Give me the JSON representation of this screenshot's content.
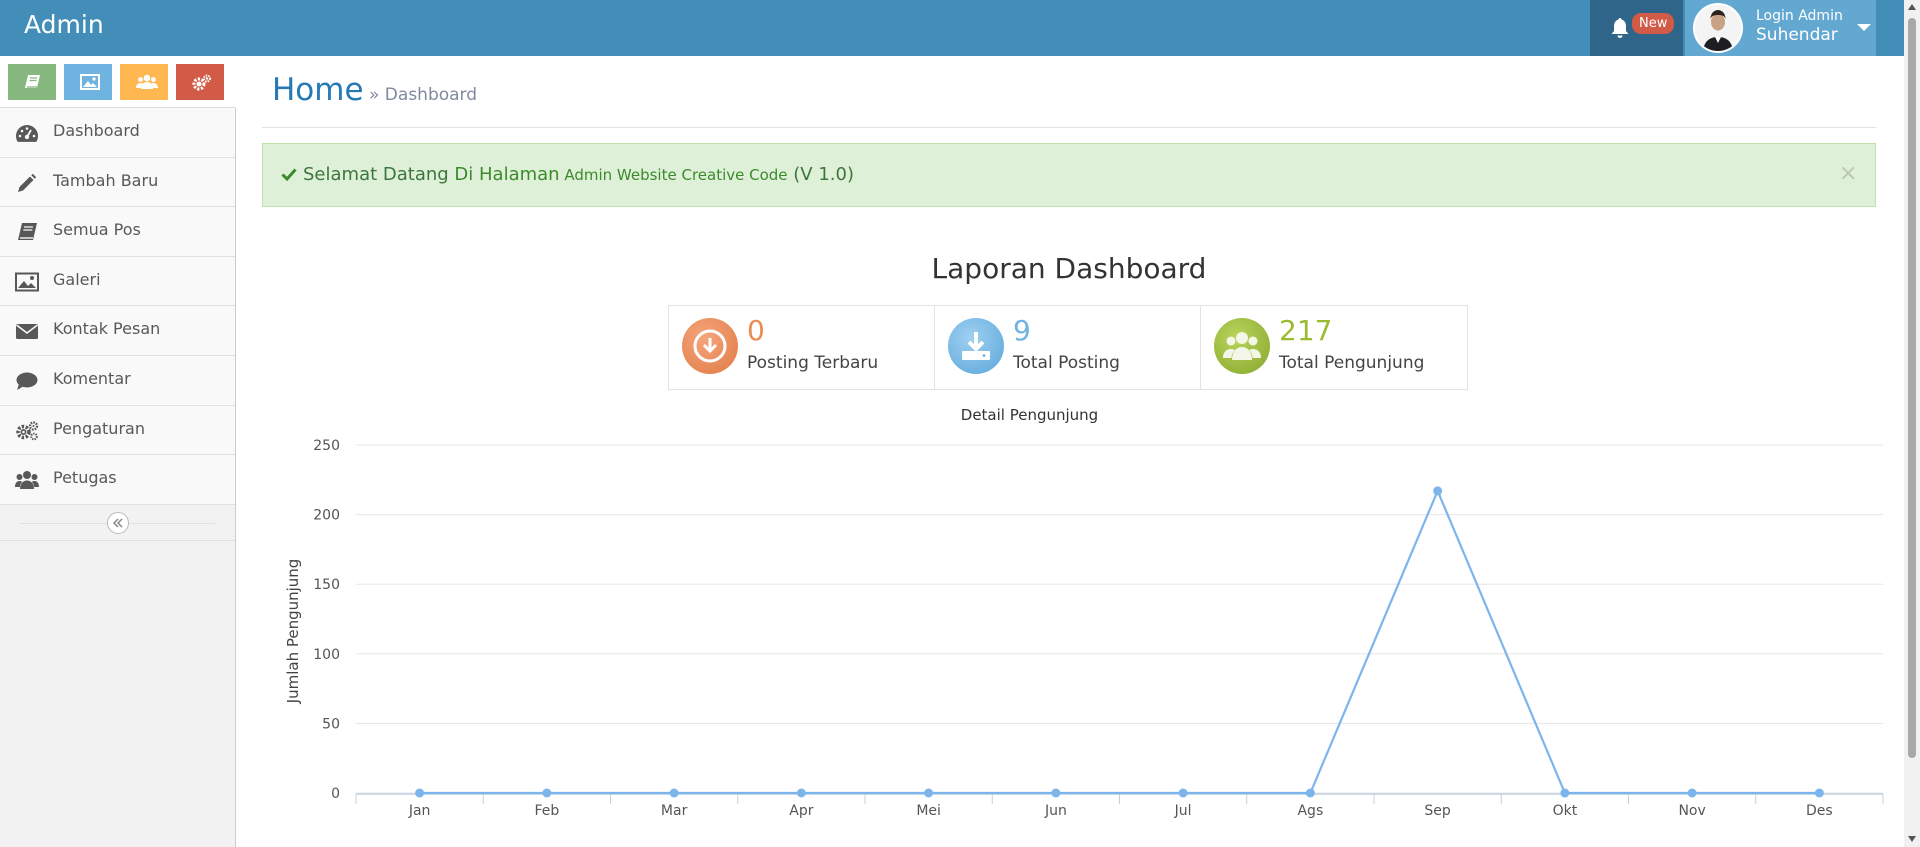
{
  "navbar": {
    "brand": "Admin",
    "notif_badge": "New",
    "user_small": "Login Admin",
    "user_name": "Suhendar"
  },
  "sidebar": {
    "shortcuts": [
      {
        "name": "book-icon",
        "color": "#87b87f"
      },
      {
        "name": "picture-icon",
        "color": "#6fb3e0"
      },
      {
        "name": "users-icon",
        "color": "#ffb752"
      },
      {
        "name": "cogs-icon",
        "color": "#d15b47"
      }
    ],
    "items": [
      {
        "label": "Dashboard",
        "icon": "dashboard-icon"
      },
      {
        "label": "Tambah Baru",
        "icon": "pencil-icon"
      },
      {
        "label": "Semua Pos",
        "icon": "book-icon"
      },
      {
        "label": "Galeri",
        "icon": "picture-icon"
      },
      {
        "label": "Kontak Pesan",
        "icon": "envelope-icon"
      },
      {
        "label": "Komentar",
        "icon": "comment-icon"
      },
      {
        "label": "Pengaturan",
        "icon": "cogs-icon"
      },
      {
        "label": "Petugas",
        "icon": "users-icon"
      }
    ]
  },
  "main": {
    "title": "Home",
    "breadcrumb": "» Dashboard",
    "alert": {
      "prefix": "Selamat Datang ",
      "highlight": "Di Halaman",
      "small": " Admin Website Creative Code",
      "suffix": " (V 1.0)",
      "close": "×"
    },
    "dash_title": "Laporan Dashboard",
    "stats": [
      {
        "value": "0",
        "label": "Posting Terbaru",
        "color": "#e98c58",
        "icon": "download-circle-icon"
      },
      {
        "value": "9",
        "label": "Total Posting",
        "color": "#6fb3e0",
        "icon": "download-icon"
      },
      {
        "value": "217",
        "label": "Total Pengunjung",
        "color": "#9abc32",
        "icon": "users-icon"
      }
    ]
  },
  "chart_data": {
    "type": "line",
    "title": "Detail Pengunjung",
    "ylabel": "Jumlah Pengunjung",
    "xlabel": "",
    "categories": [
      "Jan",
      "Feb",
      "Mar",
      "Apr",
      "Mei",
      "Jun",
      "Jul",
      "Ags",
      "Sep",
      "Okt",
      "Nov",
      "Des"
    ],
    "series": [
      {
        "values": [
          0,
          0,
          0,
          0,
          0,
          0,
          0,
          0,
          217,
          0,
          0,
          0
        ],
        "color": "#7cb5ec"
      }
    ],
    "ylim": [
      0,
      250
    ],
    "yticks": [
      0,
      50,
      100,
      150,
      200,
      250
    ],
    "grid": true
  }
}
